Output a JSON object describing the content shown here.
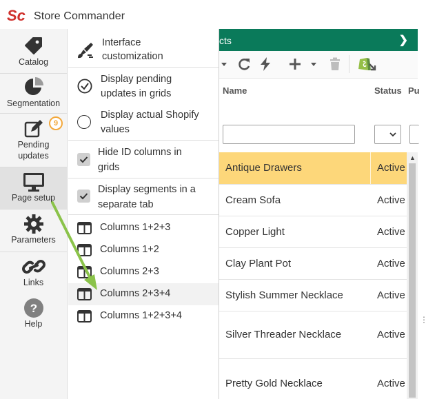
{
  "app": {
    "title": "Store Commander",
    "logo_text": "Sc"
  },
  "sidebar": {
    "items": [
      {
        "label": "Catalog",
        "icon": "tag-icon"
      },
      {
        "label": "Segmentation",
        "icon": "pie-chart-icon"
      },
      {
        "label": "Pending updates",
        "label_line1": "Pending",
        "label_line2": "updates",
        "icon": "edit-icon",
        "badge": "9"
      },
      {
        "label": "Page setup",
        "icon": "monitor-icon"
      },
      {
        "label": "Parameters",
        "icon": "gear-icon"
      },
      {
        "label": "Links",
        "icon": "link-icon"
      },
      {
        "label": "Help",
        "icon": "help-icon"
      }
    ]
  },
  "menu": {
    "items": [
      {
        "line1": "Interface",
        "line2": "customization",
        "icon": "brush-icon"
      },
      {
        "line1": "Display pending",
        "line2": "updates in grids",
        "icon": "check-circle-icon"
      },
      {
        "line1": "Display actual Shopify",
        "line2": "values",
        "icon": "empty-circle-icon"
      },
      {
        "line1": "Hide ID columns in",
        "line2": "grids",
        "icon": "checkbox-checked-icon"
      },
      {
        "line1": "Display segments in a",
        "line2": "separate tab",
        "icon": "checkbox-checked-icon"
      },
      {
        "line1": "Columns 1+2+3",
        "icon": "columns-icon"
      },
      {
        "line1": "Columns 1+2",
        "icon": "columns-icon"
      },
      {
        "line1": "Columns 2+3",
        "icon": "columns-icon"
      },
      {
        "line1": "Columns 2+3+4",
        "icon": "columns-icon"
      },
      {
        "line1": "Columns 1+2+3+4",
        "icon": "columns-icon"
      }
    ]
  },
  "grid": {
    "header_title": "cts",
    "columns": {
      "name": "Name",
      "status": "Status",
      "third": "Pu"
    },
    "rows": [
      {
        "name": "Antique Drawers",
        "status": "Active"
      },
      {
        "name": "Cream Sofa",
        "status": "Active"
      },
      {
        "name": "Copper Light",
        "status": "Active"
      },
      {
        "name": "Clay Plant Pot",
        "status": "Active"
      },
      {
        "name": "Stylish Summer Necklace",
        "status": "Active"
      },
      {
        "name": "Silver Threader Necklace",
        "status": "Active"
      },
      {
        "name": "Pretty Gold Necklace",
        "status": "Active"
      }
    ],
    "selected_row": 0
  },
  "colors": {
    "brand_green": "#0a7a5a",
    "selected_row": "#fdd77a",
    "badge": "#f3a83b",
    "annotation_arrow": "#8bc34a",
    "logo_red": "#d0312d"
  }
}
